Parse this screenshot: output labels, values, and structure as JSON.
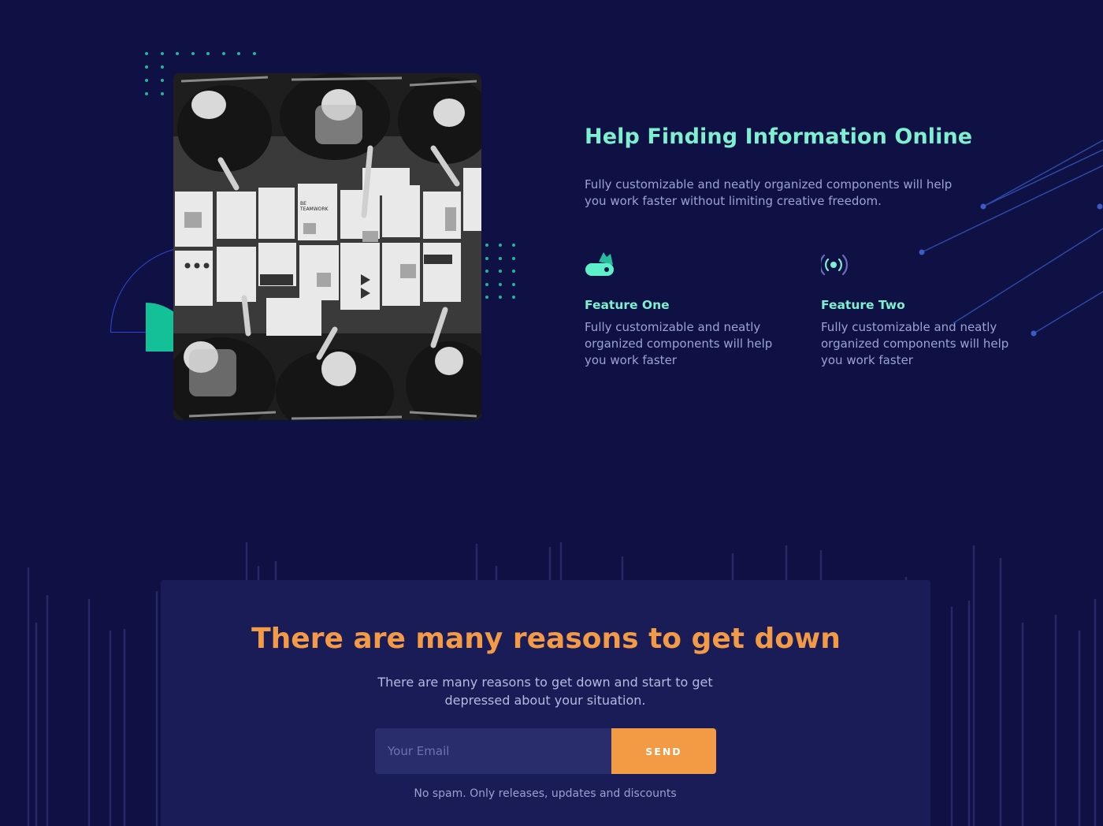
{
  "colors": {
    "background": "#0f1145",
    "accent_mint": "#7ff0cf",
    "accent_green": "#14c097",
    "accent_orange": "#f29a45",
    "text_muted": "#9aa3d6",
    "newsletter_bg": "#1a1c58"
  },
  "hero": {
    "image_alt": "Team meeting around a table viewed from above",
    "image_sign_text": "BE TEAMWORK",
    "headline": "Help Finding Information Online",
    "subtext": "Fully customizable and neatly organized components will help you work faster without limiting creative freedom."
  },
  "features": [
    {
      "icon": "toggle-switch-icon",
      "title": "Feature One",
      "text": "Fully customizable and neatly organized components will help you work faster"
    },
    {
      "icon": "broadcast-signal-icon",
      "title": "Feature Two",
      "text": "Fully customizable and neatly organized components will help you work faster"
    }
  ],
  "newsletter": {
    "title": "There are many reasons to get down",
    "text": "There are many reasons to get down and start to get depressed about your situation.",
    "email_placeholder": "Your Email",
    "button_label": "SEND",
    "note": "No spam. Only releases, updates and discounts"
  }
}
